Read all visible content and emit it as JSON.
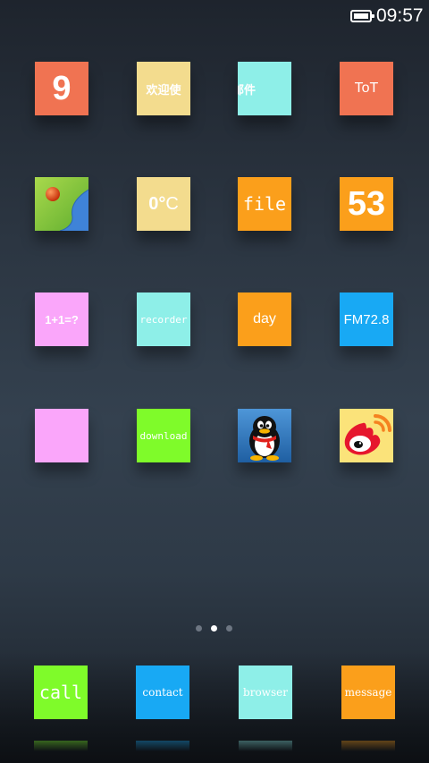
{
  "status_bar": {
    "time": "09:57",
    "battery_level_percent": 100
  },
  "colors": {
    "coral": "#f07352",
    "sand": "#f3dc8e",
    "aqua": "#8eefe8",
    "orange": "#fb9f1b",
    "pink": "#faa6fa",
    "blue": "#18a9f4",
    "lime": "#7ffb2a"
  },
  "home_grid": [
    {
      "label": "9",
      "color": "#f07352"
    },
    {
      "label": "欢迎使",
      "color": "#f3dc8e"
    },
    {
      "label": "邮件",
      "color": "#8eefe8"
    },
    {
      "label": "ToT",
      "color": "#f07352"
    },
    {
      "icon": "gallery-icon",
      "color": "#7cc243"
    },
    {
      "label_main": "0°",
      "label_unit": "C",
      "color": "#f3dc8e"
    },
    {
      "label": "file",
      "color": "#fb9f1b"
    },
    {
      "label": "53",
      "color": "#fb9f1b"
    },
    {
      "label": "1+1=?",
      "color": "#faa6fa"
    },
    {
      "label": "recorder",
      "color": "#8eefe8"
    },
    {
      "label": "day",
      "color": "#fb9f1b"
    },
    {
      "label": "FM72.8",
      "color": "#18a9f4"
    },
    {
      "label": "",
      "color": "#faa6fa"
    },
    {
      "label": "download",
      "color": "#7ffb2a"
    },
    {
      "icon": "qq-penguin-icon",
      "color": "#2f75b7"
    },
    {
      "icon": "weibo-icon",
      "color": "#fbe37a"
    }
  ],
  "page_indicator": {
    "total": 3,
    "current": 2
  },
  "dock": [
    {
      "label": "call",
      "color": "#7ffb2a"
    },
    {
      "label": "contact",
      "color": "#18a9f4"
    },
    {
      "label": "browser",
      "color": "#8eefe8"
    },
    {
      "label": "message",
      "color": "#fb9f1b"
    }
  ]
}
